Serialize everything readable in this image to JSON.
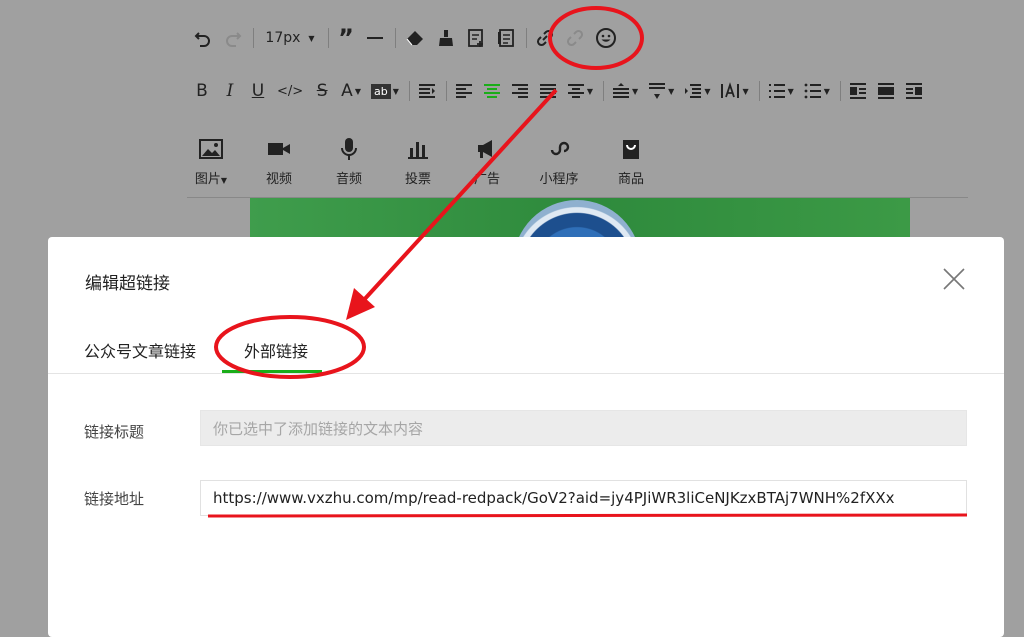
{
  "toolbar": {
    "font_size": "17px",
    "row1_icons": [
      "undo-icon",
      "redo-icon",
      "font-size-select",
      "blockquote-icon",
      "horizontal-rule-icon",
      "eraser-icon",
      "format-brush-icon",
      "template-icon",
      "document-icon",
      "insert-link-icon",
      "unlink-icon",
      "emoji-icon"
    ],
    "row2_icons": [
      "bold",
      "italic",
      "underline",
      "code",
      "strikethrough",
      "font-color",
      "background-color",
      "indent",
      "align-left",
      "align-center",
      "align-right",
      "justify",
      "alignment-more",
      "line-height",
      "paragraph-spacing",
      "indent-size",
      "letter-spacing",
      "ordered-list",
      "unordered-list",
      "float-left",
      "float-none",
      "float-right"
    ]
  },
  "media": {
    "image": "图片",
    "video": "视频",
    "audio": "音频",
    "vote": "投票",
    "ad": "广告",
    "mini_program": "小程序",
    "product": "商品"
  },
  "dialog": {
    "title": "编辑超链接",
    "tabs": [
      "公众号文章链接",
      "外部链接"
    ],
    "active_tab": "外部链接",
    "link_title_label": "链接标题",
    "link_title_placeholder": "你已选中了添加链接的文本内容",
    "link_url_label": "链接地址",
    "link_url_value": "https://www.vxzhu.com/mp/read-redpack/GoV2?aid=jy4PJiWR3liCeNJKzxBTAj7WNH%2fXXx"
  },
  "colors": {
    "accent": "#1aad19",
    "annotation": "#e8141c",
    "overlay": "#a0a0a0"
  }
}
